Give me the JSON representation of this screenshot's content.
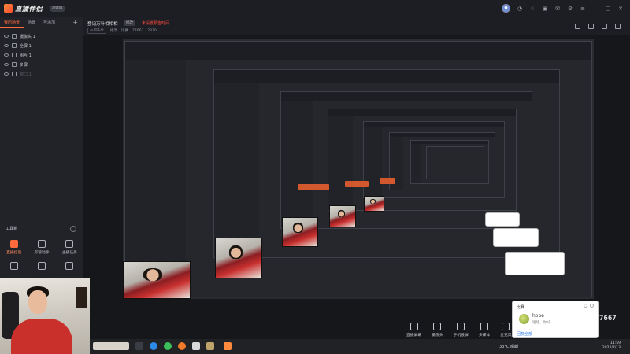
{
  "app": {
    "logo_text": "直播伴侣",
    "version_badge": "测试版"
  },
  "left_panel": {
    "tabs": [
      "我的场景",
      "场景",
      "可添加"
    ],
    "sources": [
      {
        "label": "摄像头 1",
        "dim": false
      },
      {
        "label": "全屏 1",
        "dim": false
      },
      {
        "label": "图片 1",
        "dim": false
      },
      {
        "label": "多屏",
        "dim": false
      },
      {
        "label": "窗口 1",
        "dim": true
      }
    ],
    "toolbox_title": "工具箱",
    "tools": [
      {
        "label": "直播红包",
        "hot": true
      },
      {
        "label": "房管助手",
        "hot": false
      },
      {
        "label": "主播任务",
        "hot": false
      },
      {
        "label": "",
        "hot": false
      },
      {
        "label": "",
        "hot": false
      },
      {
        "label": "",
        "hot": false
      }
    ]
  },
  "main": {
    "live_title": "登记万叶相相相",
    "live_tag": "修改",
    "live_status": "未设置预告时间",
    "meta": [
      "三周年庆",
      "修改",
      "比赛",
      "77667",
      "2370"
    ]
  },
  "bottom_tools": [
    "直播屏幕",
    "摄像头",
    "手机投屏",
    "多媒体",
    "麦克风"
  ],
  "popup": {
    "title": "比赛",
    "name": "hope",
    "message": "哈哈，你好",
    "link": "回复全部"
  },
  "viewer_count": "7667",
  "taskbar": {
    "weather": "33°C 晴朗",
    "time": "11:59",
    "date": "2022/7/13"
  }
}
